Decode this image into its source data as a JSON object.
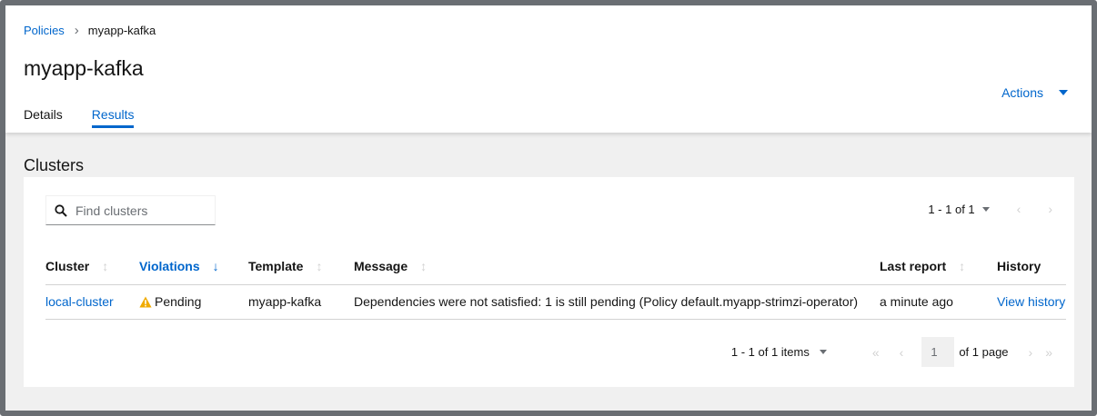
{
  "breadcrumb": {
    "parent": "Policies",
    "current": "myapp-kafka"
  },
  "page": {
    "title": "myapp-kafka",
    "actions_label": "Actions"
  },
  "tabs": [
    {
      "label": "Details"
    },
    {
      "label": "Results"
    }
  ],
  "section": {
    "title": "Clusters"
  },
  "search": {
    "placeholder": "Find clusters"
  },
  "pager_top": {
    "range": "1 - 1 of 1"
  },
  "table": {
    "headers": {
      "cluster": "Cluster",
      "violations": "Violations",
      "template": "Template",
      "message": "Message",
      "last_report": "Last report",
      "history": "History"
    },
    "rows": [
      {
        "cluster": "local-cluster",
        "violations": "Pending",
        "template": "myapp-kafka",
        "message": "Dependencies were not satisfied: 1 is still pending (Policy default.myapp-strimzi-operator)",
        "last_report": "a minute ago",
        "history": "View history"
      }
    ]
  },
  "pager_bottom": {
    "range": "1 - 1 of 1 items",
    "page": "1",
    "of_pages": "of 1 page"
  },
  "colors": {
    "link": "#0066cc",
    "warning": "#f0ab00",
    "frame": "#6a6e73"
  }
}
